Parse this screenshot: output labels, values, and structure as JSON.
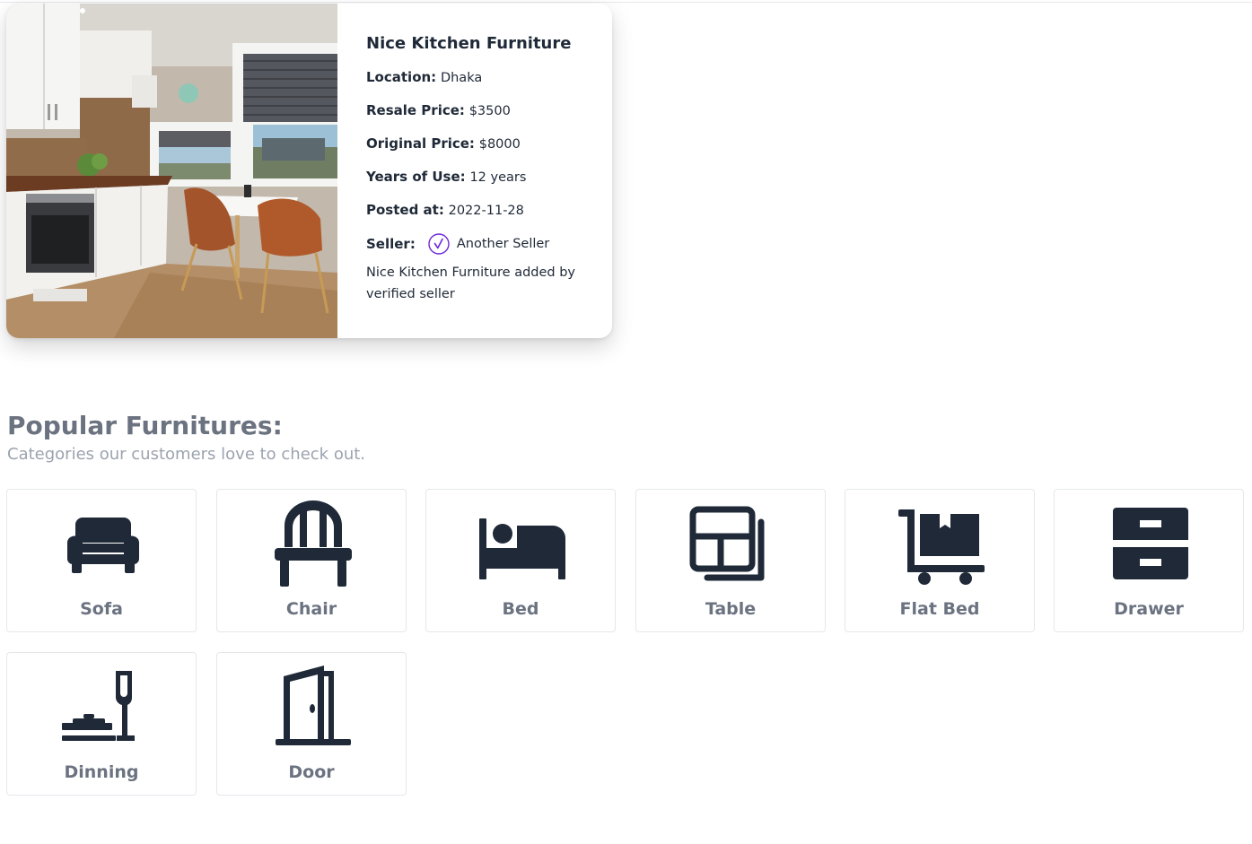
{
  "listing": {
    "title": "Nice Kitchen Furniture",
    "location_label": "Location:",
    "location": "Dhaka",
    "resale_label": "Resale Price:",
    "resale_price": "$3500",
    "original_label": "Original Price:",
    "original_price": "$8000",
    "years_label": "Years of Use:",
    "years": "12 years",
    "posted_label": "Posted at:",
    "posted": "2022-11-28",
    "seller_label": "Seller:",
    "seller": "Another Seller",
    "description": "Nice Kitchen Furniture added by verified seller",
    "verified_color": "#6d28d9"
  },
  "section": {
    "title": "Popular Furnitures:",
    "subtitle": "Categories our customers love to check out."
  },
  "categories": [
    {
      "label": "Sofa",
      "icon": "sofa-icon"
    },
    {
      "label": "Chair",
      "icon": "chair-icon"
    },
    {
      "label": "Bed",
      "icon": "bed-icon"
    },
    {
      "label": "Table",
      "icon": "table-icon"
    },
    {
      "label": "Flat Bed",
      "icon": "flatbed-cart-icon"
    },
    {
      "label": "Drawer",
      "icon": "drawer-icon"
    },
    {
      "label": "Dinning",
      "icon": "dining-icon"
    },
    {
      "label": "Door",
      "icon": "door-icon"
    }
  ],
  "colors": {
    "icon": "#1f2937",
    "label": "#6b7280",
    "subtitle": "#9ca3af"
  }
}
